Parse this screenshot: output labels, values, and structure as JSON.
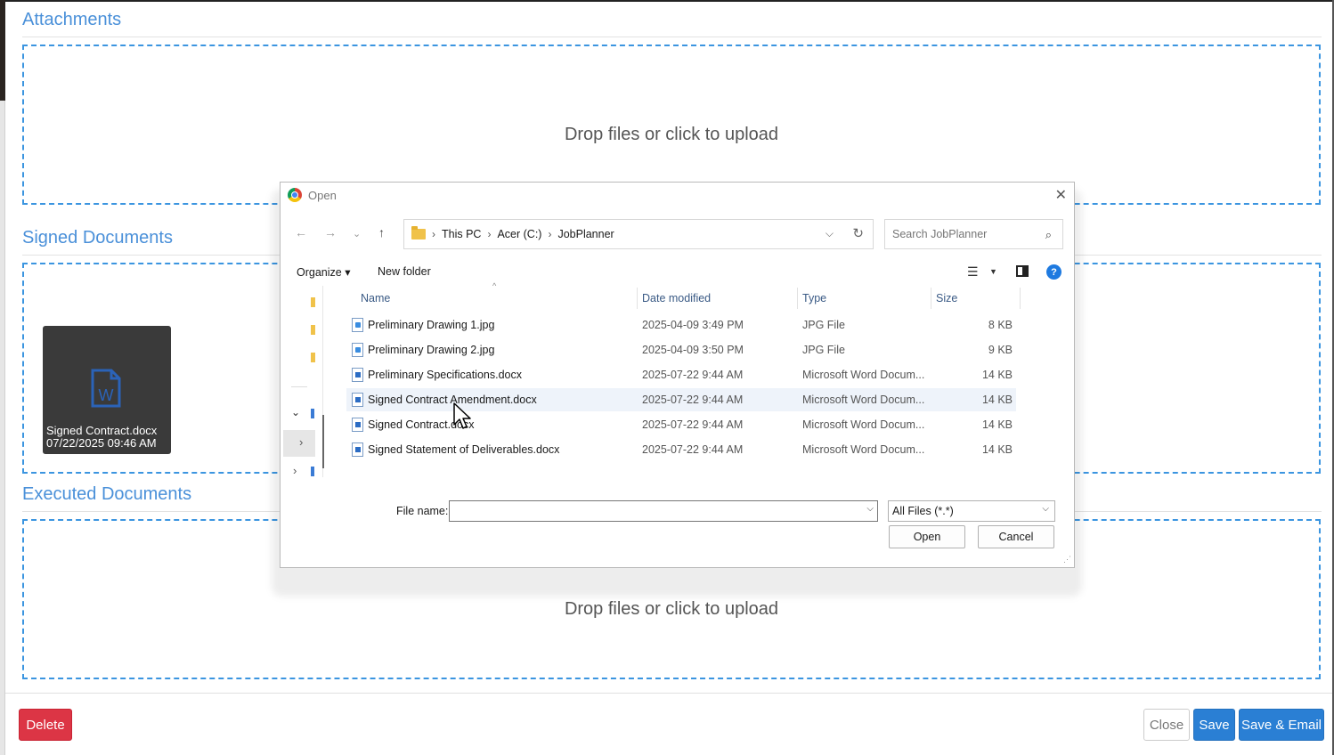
{
  "sections": {
    "attachments_title": "Attachments",
    "signed_title": "Signed Documents",
    "executed_title": "Executed Documents",
    "drop_text": "Drop files or click to upload"
  },
  "signed_doc": {
    "name": "Signed Contract.docx",
    "date": "07/22/2025 09:46 AM"
  },
  "footer": {
    "delete": "Delete",
    "close": "Close",
    "save": "Save",
    "save_email": "Save & Email"
  },
  "dialog": {
    "title": "Open",
    "close_glyph": "✕",
    "breadcrumb": [
      "This PC",
      "Acer (C:)",
      "JobPlanner"
    ],
    "search_placeholder": "Search JobPlanner",
    "organize": "Organize ▾",
    "new_folder": "New folder",
    "help": "?",
    "columns": {
      "name": "Name",
      "date": "Date modified",
      "type": "Type",
      "size": "Size"
    },
    "files": [
      {
        "name": "Preliminary Drawing 1.jpg",
        "date": "2025-04-09 3:49 PM",
        "type": "JPG File",
        "size": "8 KB",
        "kind": "image"
      },
      {
        "name": "Preliminary Drawing 2.jpg",
        "date": "2025-04-09 3:50 PM",
        "type": "JPG File",
        "size": "9 KB",
        "kind": "image"
      },
      {
        "name": "Preliminary Specifications.docx",
        "date": "2025-07-22 9:44 AM",
        "type": "Microsoft Word Docum...",
        "size": "14 KB",
        "kind": "word"
      },
      {
        "name": "Signed Contract Amendment.docx",
        "date": "2025-07-22 9:44 AM",
        "type": "Microsoft Word Docum...",
        "size": "14 KB",
        "kind": "word"
      },
      {
        "name": "Signed Contract.docx",
        "date": "2025-07-22 9:44 AM",
        "type": "Microsoft Word Docum...",
        "size": "14 KB",
        "kind": "word"
      },
      {
        "name": "Signed Statement of Deliverables.docx",
        "date": "2025-07-22 9:44 AM",
        "type": "Microsoft Word Docum...",
        "size": "14 KB",
        "kind": "word"
      }
    ],
    "file_name_label": "File name:",
    "file_name_value": "",
    "file_type": "All Files (*.*)",
    "open_button": "Open",
    "cancel_button": "Cancel"
  },
  "colors": {
    "accent": "#4a90d9",
    "dropzone_border": "#3b95e0",
    "delete": "#dc3545",
    "primary": "#2a7fd4"
  }
}
